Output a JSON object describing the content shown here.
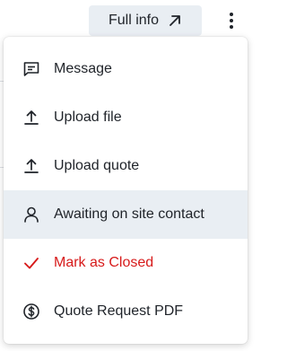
{
  "header": {
    "full_info_label": "Full info",
    "full_info_icon": "arrow-up-right-icon",
    "more_icon": "vertical-ellipsis-icon"
  },
  "menu": {
    "items": [
      {
        "label": "Message",
        "icon": "message-icon"
      },
      {
        "label": "Upload file",
        "icon": "upload-icon"
      },
      {
        "label": "Upload quote",
        "icon": "upload-icon"
      },
      {
        "label": "Awaiting on site contact",
        "icon": "person-icon",
        "highlighted": true
      },
      {
        "label": "Mark as Closed",
        "icon": "checkmark-icon",
        "color": "#d71a1a"
      },
      {
        "label": "Quote Request PDF",
        "icon": "dollar-circle-icon"
      }
    ]
  },
  "colors": {
    "highlight": "#e9eef3",
    "danger": "#d71a1a",
    "text": "#1f2329"
  }
}
